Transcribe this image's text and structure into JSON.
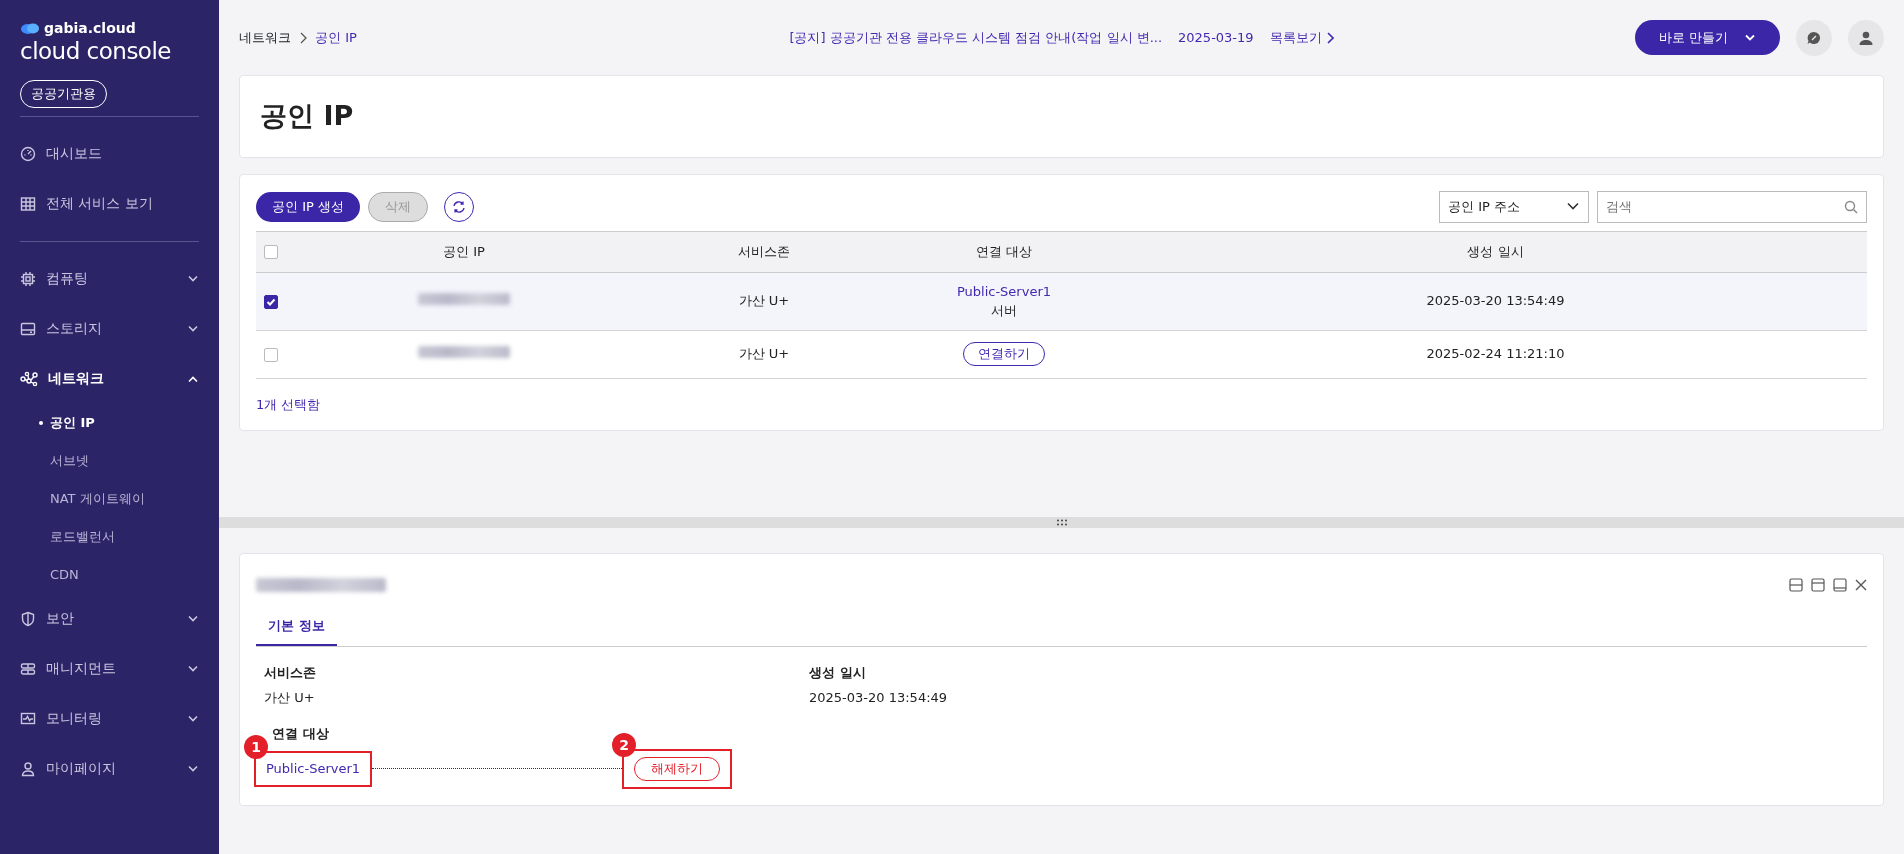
{
  "brand": {
    "name": "gabia.cloud",
    "product": "cloud console",
    "badge": "공공기관용"
  },
  "sidebar": {
    "top_items": [
      {
        "label": "대시보드"
      },
      {
        "label": "전체 서비스 보기"
      }
    ],
    "groups": [
      {
        "label": "컴퓨팅",
        "expanded": false
      },
      {
        "label": "스토리지",
        "expanded": false
      },
      {
        "label": "네트워크",
        "expanded": true,
        "children": [
          {
            "label": "공인 IP",
            "selected": true
          },
          {
            "label": "서브넷",
            "selected": false
          },
          {
            "label": "NAT 게이트웨이",
            "selected": false
          },
          {
            "label": "로드밸런서",
            "selected": false
          },
          {
            "label": "CDN",
            "selected": false
          }
        ]
      },
      {
        "label": "보안",
        "expanded": false
      },
      {
        "label": "매니지먼트",
        "expanded": false
      },
      {
        "label": "모니터링",
        "expanded": false
      },
      {
        "label": "마이페이지",
        "expanded": false
      }
    ]
  },
  "breadcrumb": [
    "네트워크",
    "공인 IP"
  ],
  "notice": {
    "text": "[공지] 공공기관 전용 클라우드 시스템 점검 안내(작업 일시 변...",
    "date": "2025-03-19",
    "link": "목록보기"
  },
  "create_button": "바로 만들기",
  "page_title": "공인 IP",
  "toolbar": {
    "create": "공인 IP 생성",
    "delete": {
      "label": "삭제",
      "disabled": true
    },
    "filter": "공인 IP 주소",
    "search_placeholder": "검색"
  },
  "table": {
    "header_checked": false,
    "columns": [
      "공인 IP",
      "서비스존",
      "연결 대상",
      "생성 일시"
    ],
    "rows": [
      {
        "checked": true,
        "zone": "가산 U+",
        "target": {
          "kind": "link",
          "name": "Public-Server1",
          "type": "서버"
        },
        "created": "2025-03-20 13:54:49"
      },
      {
        "checked": false,
        "zone": "가산 U+",
        "target": {
          "kind": "button",
          "label": "연결하기"
        },
        "created": "2025-02-24 11:21:10"
      }
    ]
  },
  "selection_text": "1개 선택함",
  "detail": {
    "tabs": [
      {
        "label": "기본 정보",
        "selected": true
      }
    ],
    "fields": [
      {
        "label": "서비스존",
        "value": "가산 U+"
      },
      {
        "label": "생성 일시",
        "value": "2025-03-20 13:54:49"
      }
    ],
    "target": {
      "label": "연결 대상",
      "link": "Public-Server1",
      "action": "해제하기"
    },
    "annotations": [
      "1",
      "2"
    ]
  }
}
